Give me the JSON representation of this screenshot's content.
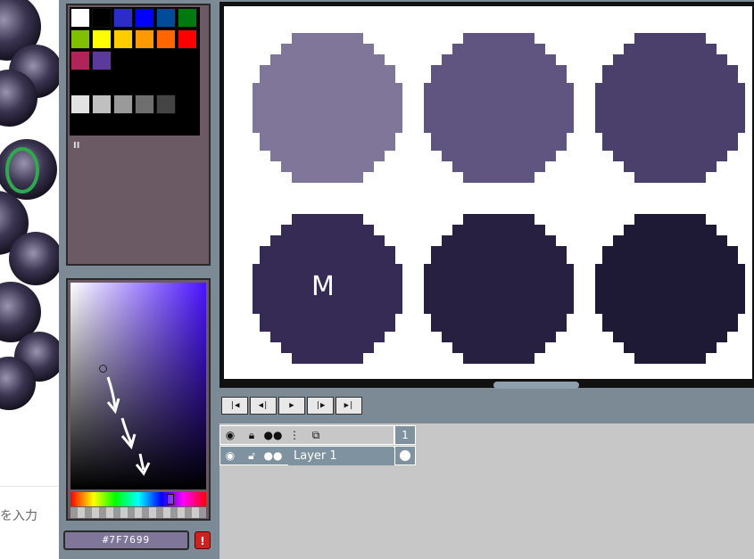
{
  "reference": {
    "input_hint": "を入力",
    "highlight_color": "#2fa84e"
  },
  "palette": {
    "swatches_row1": [
      "#ffffff",
      "#000000",
      "#2c2cc8",
      "#0000ff",
      "#004a9a",
      "#007a10"
    ],
    "swatches_row2": [
      "#7fc000",
      "#ffff00",
      "#ffcc00",
      "#ff9900",
      "#ff6600",
      "#ff0000"
    ],
    "swatches_row3": [
      "#b0245a",
      "#5a3a9c"
    ],
    "grays": [
      "#e2e2e2",
      "#c0c0c0",
      "#9a9a9a",
      "#6e6e6e",
      "#444444"
    ],
    "pause_label": "II"
  },
  "color_picker": {
    "hex_value": "#7F7699",
    "warning_label": "!"
  },
  "canvas": {
    "dots": [
      {
        "color": "#7f7699"
      },
      {
        "color": "#605480"
      },
      {
        "color": "#4b3f6b"
      },
      {
        "color": "#352b55",
        "label": "M"
      },
      {
        "color": "#282040"
      },
      {
        "color": "#1e1a36"
      }
    ]
  },
  "playback": {
    "buttons": [
      "|◀",
      "◀|",
      "▶",
      "|▶",
      "▶|"
    ]
  },
  "timeline": {
    "frame_number": "1",
    "layer_name": "Layer 1",
    "header_icons": [
      "eye-icon",
      "lock-icon",
      "onion-icon",
      "tree-icon",
      "copy-icon"
    ]
  }
}
